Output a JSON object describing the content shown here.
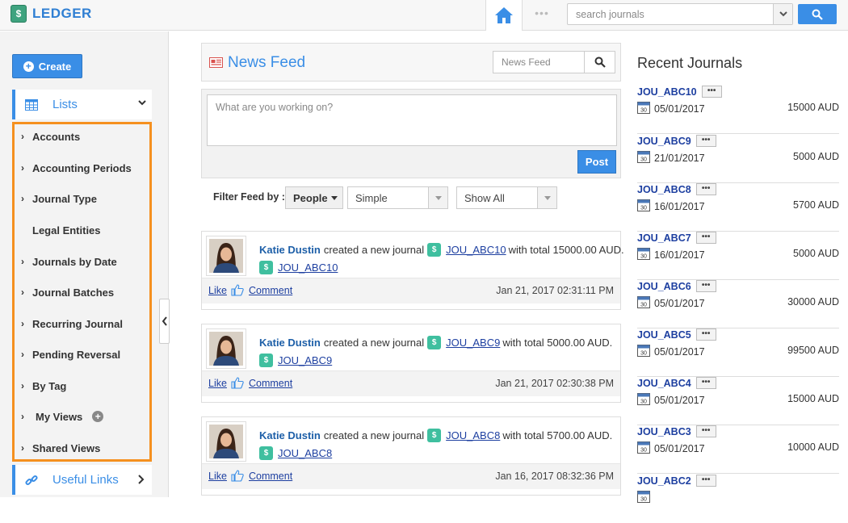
{
  "app": {
    "logo_text": "LEDGER",
    "logo_glyph": "$"
  },
  "topbar": {
    "search_placeholder": "search journals",
    "dots": "•••"
  },
  "sidebar": {
    "create_label": "Create",
    "lists_label": "Lists",
    "items": [
      {
        "label": "Accounts",
        "arrow": "›"
      },
      {
        "label": "Accounting Periods",
        "arrow": "›"
      },
      {
        "label": "Journal Type",
        "arrow": "›"
      },
      {
        "label": "Legal Entities",
        "arrow": ""
      },
      {
        "label": "Journals by Date",
        "arrow": "›"
      },
      {
        "label": "Journal Batches",
        "arrow": "›"
      },
      {
        "label": "Recurring Journal",
        "arrow": "›"
      },
      {
        "label": "Pending Reversal",
        "arrow": "›"
      },
      {
        "label": "By Tag",
        "arrow": "›"
      },
      {
        "label": "My Views",
        "arrow": "›",
        "plus": "+"
      },
      {
        "label": "Shared Views",
        "arrow": "›"
      }
    ],
    "useful_links_label": "Useful Links"
  },
  "feed": {
    "title": "News Feed",
    "search_placeholder": "News Feed",
    "post_placeholder": "What are you working on?",
    "post_label": "Post",
    "filter_label": "Filter Feed by :",
    "filter_people": "People",
    "filter_type": "Simple",
    "filter_show": "Show All",
    "posts": [
      {
        "user": "Katie Dustin",
        "action": "created a new journal",
        "journal": "JOU_ABC10",
        "total_text": "with total 15000.00 AUD.",
        "like": "Like",
        "comment": "Comment",
        "timestamp": "Jan 21, 2017 02:31:11 PM"
      },
      {
        "user": "Katie Dustin",
        "action": "created a new journal",
        "journal": "JOU_ABC9",
        "total_text": "with total 5000.00 AUD.",
        "like": "Like",
        "comment": "Comment",
        "timestamp": "Jan 21, 2017 02:30:38 PM"
      },
      {
        "user": "Katie Dustin",
        "action": "created a new journal",
        "journal": "JOU_ABC8",
        "total_text": "with total 5700.00 AUD.",
        "like": "Like",
        "comment": "Comment",
        "timestamp": "Jan 16, 2017 08:32:36 PM"
      }
    ]
  },
  "recent": {
    "title": "Recent Journals",
    "items": [
      {
        "code": "JOU_ABC10",
        "date": "05/01/2017",
        "amount": "15000 AUD"
      },
      {
        "code": "JOU_ABC9",
        "date": "21/01/2017",
        "amount": "5000 AUD"
      },
      {
        "code": "JOU_ABC8",
        "date": "16/01/2017",
        "amount": "5700 AUD"
      },
      {
        "code": "JOU_ABC7",
        "date": "16/01/2017",
        "amount": "5000 AUD"
      },
      {
        "code": "JOU_ABC6",
        "date": "05/01/2017",
        "amount": "30000 AUD"
      },
      {
        "code": "JOU_ABC5",
        "date": "05/01/2017",
        "amount": "99500 AUD"
      },
      {
        "code": "JOU_ABC4",
        "date": "05/01/2017",
        "amount": "15000 AUD"
      },
      {
        "code": "JOU_ABC3",
        "date": "05/01/2017",
        "amount": "10000 AUD"
      },
      {
        "code": "JOU_ABC2",
        "date": "",
        "amount": ""
      }
    ]
  },
  "colors": {
    "accent": "#3a8ee6",
    "highlight": "#f5901f",
    "journal_icon": "#3fbf9f"
  }
}
